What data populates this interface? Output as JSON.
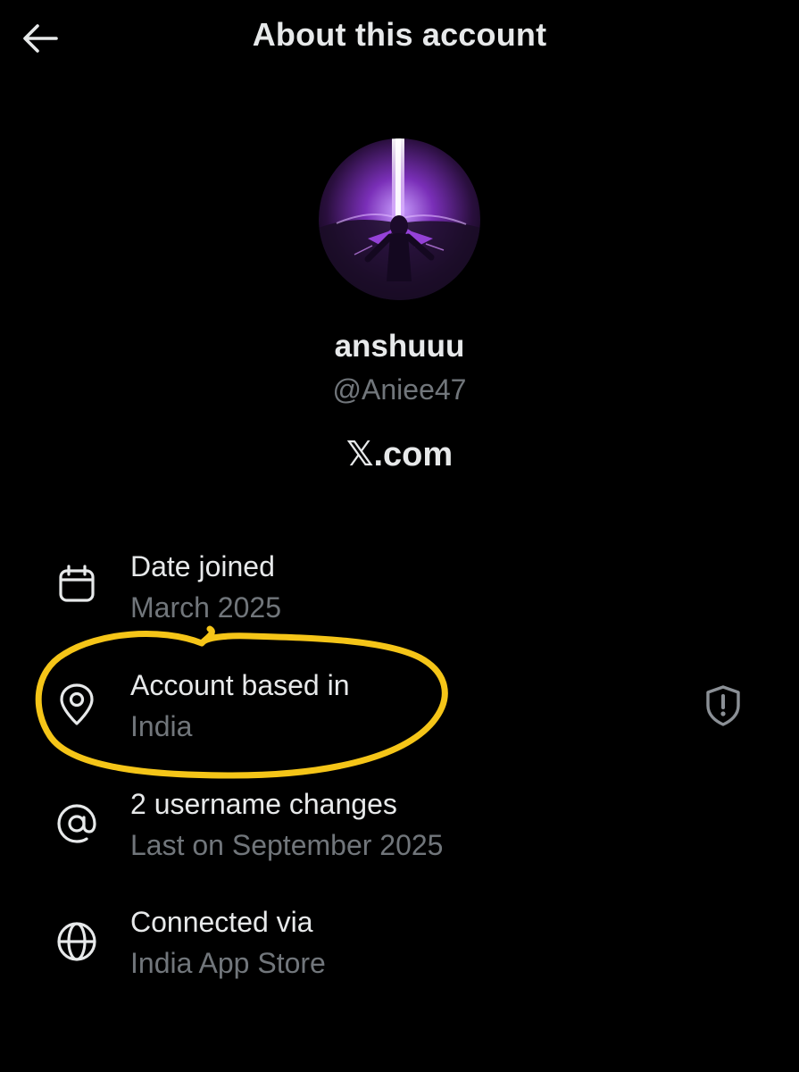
{
  "header": {
    "title": "About this account",
    "back_icon": "arrow-left-icon"
  },
  "profile": {
    "display_name": "anshuuu",
    "handle": "@Aniee47",
    "brand_mark": "𝕏",
    "brand_suffix": ".com"
  },
  "rows": [
    {
      "icon": "calendar-icon",
      "title": "Date joined",
      "subtitle": "March 2025"
    },
    {
      "icon": "location-pin-icon",
      "title": "Account based in",
      "subtitle": "India",
      "trailing_icon": "shield-alert-icon"
    },
    {
      "icon": "at-sign-icon",
      "title": "2 username changes",
      "subtitle": "Last on September 2025"
    },
    {
      "icon": "globe-icon",
      "title": "Connected via",
      "subtitle": "India App Store"
    }
  ],
  "colors": {
    "background": "#000000",
    "primary_text": "#e7e9ea",
    "secondary_text": "#71767b",
    "highlight_annotation": "#f5c518",
    "avatar_accent": "#b04dff"
  }
}
